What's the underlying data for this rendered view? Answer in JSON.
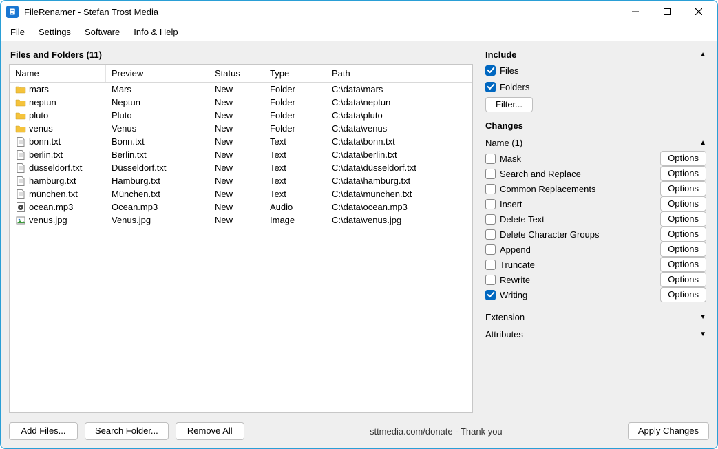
{
  "window": {
    "title": "FileRenamer - Stefan Trost Media"
  },
  "menu": {
    "file": "File",
    "settings": "Settings",
    "software": "Software",
    "info": "Info & Help"
  },
  "files_section": {
    "title": "Files and Folders (11)",
    "headers": {
      "name": "Name",
      "preview": "Preview",
      "status": "Status",
      "type": "Type",
      "path": "Path"
    },
    "rows": [
      {
        "icon": "folder",
        "name": "mars",
        "preview": "Mars",
        "status": "New",
        "type": "Folder",
        "path": "C:\\data\\mars"
      },
      {
        "icon": "folder",
        "name": "neptun",
        "preview": "Neptun",
        "status": "New",
        "type": "Folder",
        "path": "C:\\data\\neptun"
      },
      {
        "icon": "folder",
        "name": "pluto",
        "preview": "Pluto",
        "status": "New",
        "type": "Folder",
        "path": "C:\\data\\pluto"
      },
      {
        "icon": "folder",
        "name": "venus",
        "preview": "Venus",
        "status": "New",
        "type": "Folder",
        "path": "C:\\data\\venus"
      },
      {
        "icon": "doc",
        "name": "bonn.txt",
        "preview": "Bonn.txt",
        "status": "New",
        "type": "Text",
        "path": "C:\\data\\bonn.txt"
      },
      {
        "icon": "doc",
        "name": "berlin.txt",
        "preview": "Berlin.txt",
        "status": "New",
        "type": "Text",
        "path": "C:\\data\\berlin.txt"
      },
      {
        "icon": "doc",
        "name": "düsseldorf.txt",
        "preview": "Düsseldorf.txt",
        "status": "New",
        "type": "Text",
        "path": "C:\\data\\düsseldorf.txt"
      },
      {
        "icon": "doc",
        "name": "hamburg.txt",
        "preview": "Hamburg.txt",
        "status": "New",
        "type": "Text",
        "path": "C:\\data\\hamburg.txt"
      },
      {
        "icon": "doc",
        "name": "münchen.txt",
        "preview": "München.txt",
        "status": "New",
        "type": "Text",
        "path": "C:\\data\\münchen.txt"
      },
      {
        "icon": "audio",
        "name": "ocean.mp3",
        "preview": "Ocean.mp3",
        "status": "New",
        "type": "Audio",
        "path": "C:\\data\\ocean.mp3"
      },
      {
        "icon": "image",
        "name": "venus.jpg",
        "preview": "Venus.jpg",
        "status": "New",
        "type": "Image",
        "path": "C:\\data\\venus.jpg"
      }
    ]
  },
  "sidebar": {
    "include": {
      "title": "Include",
      "files_label": "Files",
      "files_checked": true,
      "folders_label": "Folders",
      "folders_checked": true,
      "filter_button": "Filter..."
    },
    "changes": {
      "title": "Changes",
      "name_header": "Name (1)",
      "options_label": "Options",
      "items": [
        {
          "label": "Mask",
          "checked": false
        },
        {
          "label": "Search and Replace",
          "checked": false
        },
        {
          "label": "Common Replacements",
          "checked": false
        },
        {
          "label": "Insert",
          "checked": false
        },
        {
          "label": "Delete Text",
          "checked": false
        },
        {
          "label": "Delete Character Groups",
          "checked": false
        },
        {
          "label": "Append",
          "checked": false
        },
        {
          "label": "Truncate",
          "checked": false
        },
        {
          "label": "Rewrite",
          "checked": false
        },
        {
          "label": "Writing",
          "checked": true
        }
      ],
      "extension_header": "Extension",
      "attributes_header": "Attributes"
    }
  },
  "bottom": {
    "add_files": "Add Files...",
    "search_folder": "Search Folder...",
    "remove_all": "Remove All",
    "donate": "sttmedia.com/donate - Thank you",
    "apply": "Apply Changes"
  }
}
